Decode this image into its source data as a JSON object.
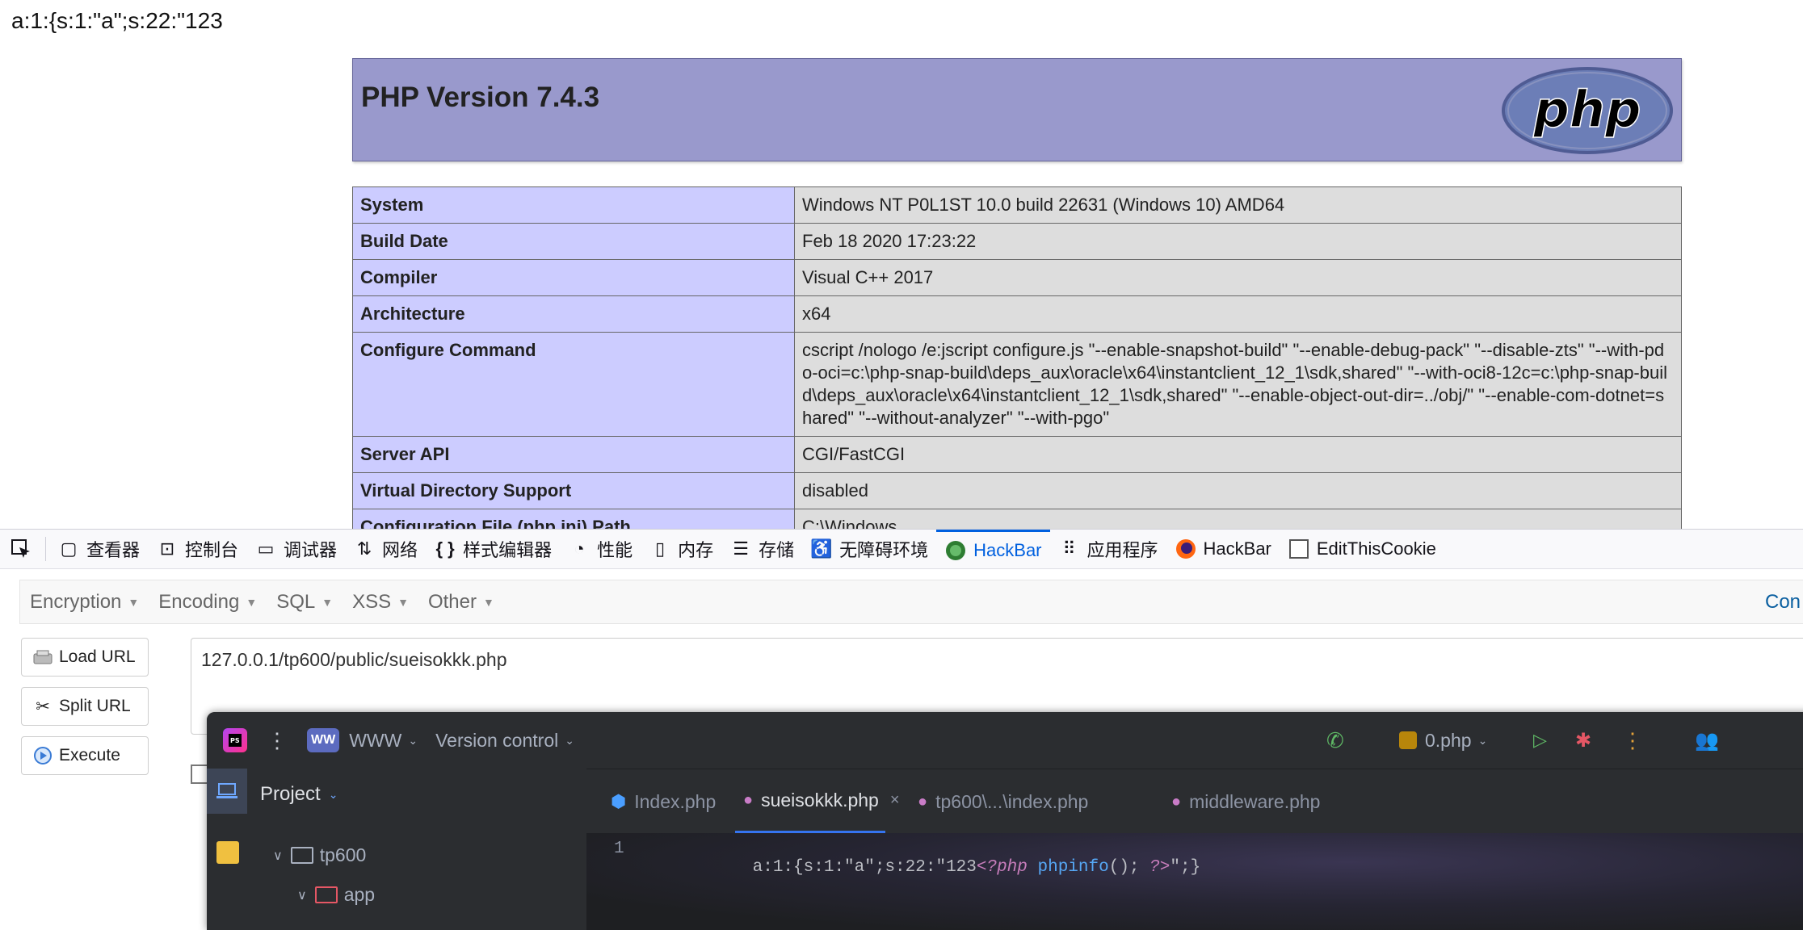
{
  "page": {
    "top_output": "a:1:{s:1:\"a\";s:22:\"123",
    "php_version_title": "PHP Version 7.4.3",
    "logo_text": "php",
    "rows": [
      {
        "label": "System",
        "value": "Windows NT P0L1ST 10.0 build 22631 (Windows 10) AMD64"
      },
      {
        "label": "Build Date",
        "value": "Feb 18 2020 17:23:22"
      },
      {
        "label": "Compiler",
        "value": "Visual C++ 2017"
      },
      {
        "label": "Architecture",
        "value": "x64"
      },
      {
        "label": "Configure Command",
        "value": "cscript /nologo /e:jscript configure.js \"--enable-snapshot-build\" \"--enable-debug-pack\" \"--disable-zts\" \"--with-pdo-oci=c:\\php-snap-build\\deps_aux\\oracle\\x64\\instantclient_12_1\\sdk,shared\" \"--with-oci8-12c=c:\\php-snap-build\\deps_aux\\oracle\\x64\\instantclient_12_1\\sdk,shared\" \"--enable-object-out-dir=../obj/\" \"--enable-com-dotnet=shared\" \"--without-analyzer\" \"--with-pgo\""
      },
      {
        "label": "Server API",
        "value": "CGI/FastCGI"
      },
      {
        "label": "Virtual Directory Support",
        "value": "disabled"
      },
      {
        "label": "Configuration File (php.ini) Path",
        "value": "C:\\Windows"
      }
    ]
  },
  "devtools": {
    "tabs": [
      {
        "label": "查看器",
        "icon": "inspector-icon"
      },
      {
        "label": "控制台",
        "icon": "console-icon"
      },
      {
        "label": "调试器",
        "icon": "debugger-icon"
      },
      {
        "label": "网络",
        "icon": "network-icon"
      },
      {
        "label": "样式编辑器",
        "icon": "style-editor-icon"
      },
      {
        "label": "性能",
        "icon": "performance-icon"
      },
      {
        "label": "内存",
        "icon": "memory-icon"
      },
      {
        "label": "存储",
        "icon": "storage-icon"
      },
      {
        "label": "无障碍环境",
        "icon": "accessibility-icon"
      },
      {
        "label": "HackBar",
        "icon": "hackbar-green-icon",
        "active": true
      },
      {
        "label": "应用程序",
        "icon": "application-icon"
      },
      {
        "label": "HackBar",
        "icon": "hackbar-firefox-icon"
      },
      {
        "label": "EditThisCookie",
        "icon": "cookie-checkbox-icon"
      }
    ],
    "active_color": "#0060df"
  },
  "hackbar": {
    "menu": [
      "Encryption",
      "Encoding",
      "SQL",
      "XSS",
      "Other"
    ],
    "menu_right": "Con",
    "buttons": {
      "load": "Load URL",
      "split": "Split URL",
      "execute": "Execute"
    },
    "url_value": "127.0.0.1/tp600/public/sueisokkk.php"
  },
  "ide": {
    "project_badge": "WW",
    "project_name": "WWW",
    "version_control": "Version control",
    "run_config": "0.php",
    "panel_title": "Project",
    "tabs": [
      {
        "label": "Index.php"
      },
      {
        "label": "sueisokkk.php",
        "active": true
      },
      {
        "label": "tp600\\...\\index.php"
      },
      {
        "label": "middleware.php"
      }
    ],
    "tree": [
      {
        "label": "tp600"
      },
      {
        "label": "app"
      }
    ],
    "line_number": "1",
    "code": {
      "literal": "a:1:{s:1:\"a\";s:22:\"123",
      "open_tag": "<?php",
      "func": "phpinfo",
      "call": "();",
      "close_tag": "?>",
      "tail": "\";}"
    },
    "accent": "#3574f0"
  }
}
